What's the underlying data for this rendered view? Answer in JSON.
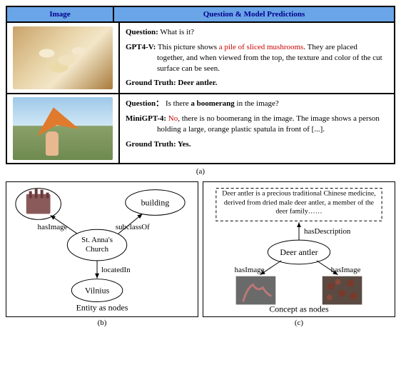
{
  "panel_a": {
    "header_image": "Image",
    "header_qa": "Question & Model Predictions",
    "rows": [
      {
        "question_label": "Question:",
        "question_text": " What is it?",
        "model_label": "GPT4-V:",
        "model_pre": " This picture shows ",
        "model_red": "a pile of sliced mushrooms",
        "model_post1": ". They are placed",
        "model_cont": "together, and when viewed from the top, the texture and color of the cut surface can be seen.",
        "gt_label": "Ground Truth:",
        "gt_text": " Deer antler."
      },
      {
        "question_label": "Question：",
        "question_text_pre": " Is there ",
        "question_text_bold": "a boomerang",
        "question_text_post": " in the image?",
        "model_label": "MiniGPT-4:",
        "model_red": " No",
        "model_post1": ", there is no boomerang in the image. The image shows a person",
        "model_cont": "holding a large, orange plastic spatula in front of [...].",
        "gt_label": "Ground Truth:",
        "gt_text": " Yes."
      }
    ],
    "caption": "(a)"
  },
  "panel_b": {
    "edge_hasImage": "hasImage",
    "edge_subclassOf": "subclassOf",
    "edge_locatedIn": "locatedIn",
    "node_building": "building",
    "node_church1": "St. Anna's",
    "node_church2": "Church",
    "node_vilnius": "Vilnius",
    "title": "Entity as nodes",
    "caption": "(b)"
  },
  "panel_c": {
    "desc": "Deer antler is a precious traditional Chinese medicine, derived from dried male deer antler, a member of the deer family……",
    "edge_hasDescription": "hasDescription",
    "edge_hasImage_l": "hasImage",
    "edge_hasImage_r": "hasImage",
    "node_deer": "Deer antler",
    "title": "Concept as nodes",
    "caption": "(c)"
  }
}
